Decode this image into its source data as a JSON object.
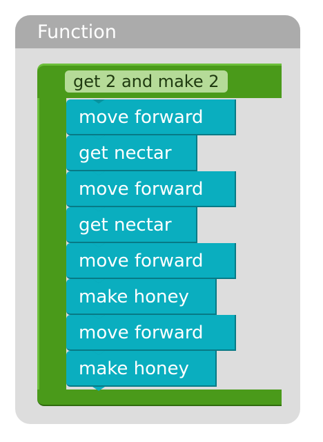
{
  "panel": {
    "title": "Function"
  },
  "function_block": {
    "name": "get 2 and make 2",
    "commands": [
      {
        "label": "move forward"
      },
      {
        "label": "get nectar"
      },
      {
        "label": "move forward"
      },
      {
        "label": "get nectar"
      },
      {
        "label": "move forward"
      },
      {
        "label": "make honey"
      },
      {
        "label": "move forward"
      },
      {
        "label": "make honey"
      }
    ]
  },
  "colors": {
    "panel_bg": "#dddddd",
    "header_bg": "#ababab",
    "function_green": "#4a9a1a",
    "name_field": "#b5db98",
    "command_teal": "#0aaebf"
  }
}
